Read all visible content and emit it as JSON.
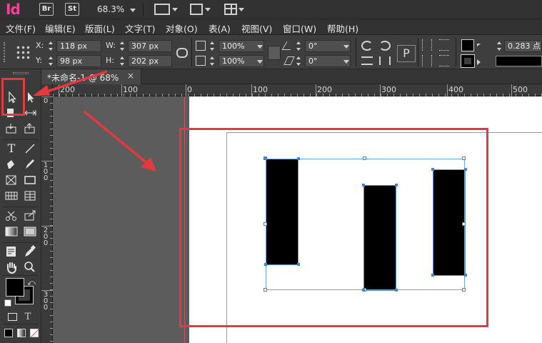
{
  "app": {
    "logo": "Id",
    "bridge": "Br",
    "stock": "St",
    "zoom": "68.3%"
  },
  "menu": [
    "文件(F)",
    "编辑(E)",
    "版面(L)",
    "文字(T)",
    "对象(O)",
    "表(A)",
    "视图(V)",
    "窗口(W)",
    "帮助(H)"
  ],
  "control": {
    "x_label": "X:",
    "x_value": "118 px",
    "y_label": "Y:",
    "y_value": "98 px",
    "w_label": "W:",
    "w_value": "307 px",
    "h_label": "H:",
    "h_value": "202 px",
    "scale_x": "100%",
    "scale_y": "100%",
    "rotate": "0°",
    "shear": "0°",
    "stroke_weight": "0.283 点"
  },
  "tab": {
    "label": "*未命名-1 @ 68%",
    "close": "×"
  },
  "ruler": {
    "h_labels": [
      "200",
      "100",
      "0",
      "100",
      "200",
      "300",
      "400",
      "500"
    ],
    "v_labels": [
      [
        "0"
      ],
      [
        "1",
        "0",
        "0"
      ],
      [
        "2",
        "0",
        "0"
      ],
      [
        "3",
        "0",
        "0"
      ]
    ]
  },
  "tools": {
    "type_glyph": "T",
    "frame_text_glyph": "T"
  },
  "colors": {
    "accent_highlight": "#e4393e",
    "selection": "#4a8fd8",
    "logo": "#ff3d9c"
  }
}
